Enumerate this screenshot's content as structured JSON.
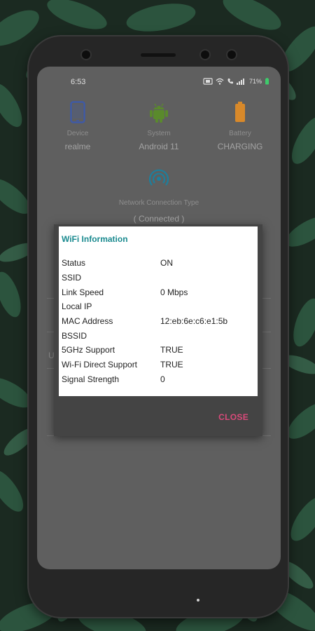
{
  "status_bar": {
    "time": "6:53",
    "battery_percent": "71%"
  },
  "header": {
    "device": {
      "label": "Device",
      "value": "realme"
    },
    "system": {
      "label": "System",
      "value": "Android 11"
    },
    "battery": {
      "label": "Battery",
      "value": "CHARGING"
    }
  },
  "network": {
    "label": "Network Connection Type",
    "status": "( Connected )"
  },
  "background": {
    "partial_text": "U"
  },
  "dialog": {
    "title": "WiFi Information",
    "rows": [
      {
        "key": "Status",
        "value": "ON"
      },
      {
        "key": "SSID",
        "value": ""
      },
      {
        "key": "Link Speed",
        "value": "0 Mbps"
      },
      {
        "key": "Local IP",
        "value": ""
      },
      {
        "key": "MAC Address",
        "value": "12:eb:6e:c6:e1:5b"
      },
      {
        "key": "BSSID",
        "value": ""
      },
      {
        "key": "5GHz Support",
        "value": "TRUE"
      },
      {
        "key": "Wi-Fi Direct Support",
        "value": "TRUE"
      },
      {
        "key": "Signal Strength",
        "value": "0"
      }
    ],
    "close_label": "CLOSE"
  },
  "colors": {
    "accent_title": "#1a8a8f",
    "close_button": "#d94a7a",
    "device_icon": "#3f5aa6",
    "system_icon": "#5a8a2c",
    "battery_icon": "#d8892a",
    "network_icon": "#1e7f9c"
  },
  "icons": {
    "device": "phone-icon",
    "system": "android-icon",
    "battery": "battery-icon",
    "network": "wifi-signal-icon"
  }
}
